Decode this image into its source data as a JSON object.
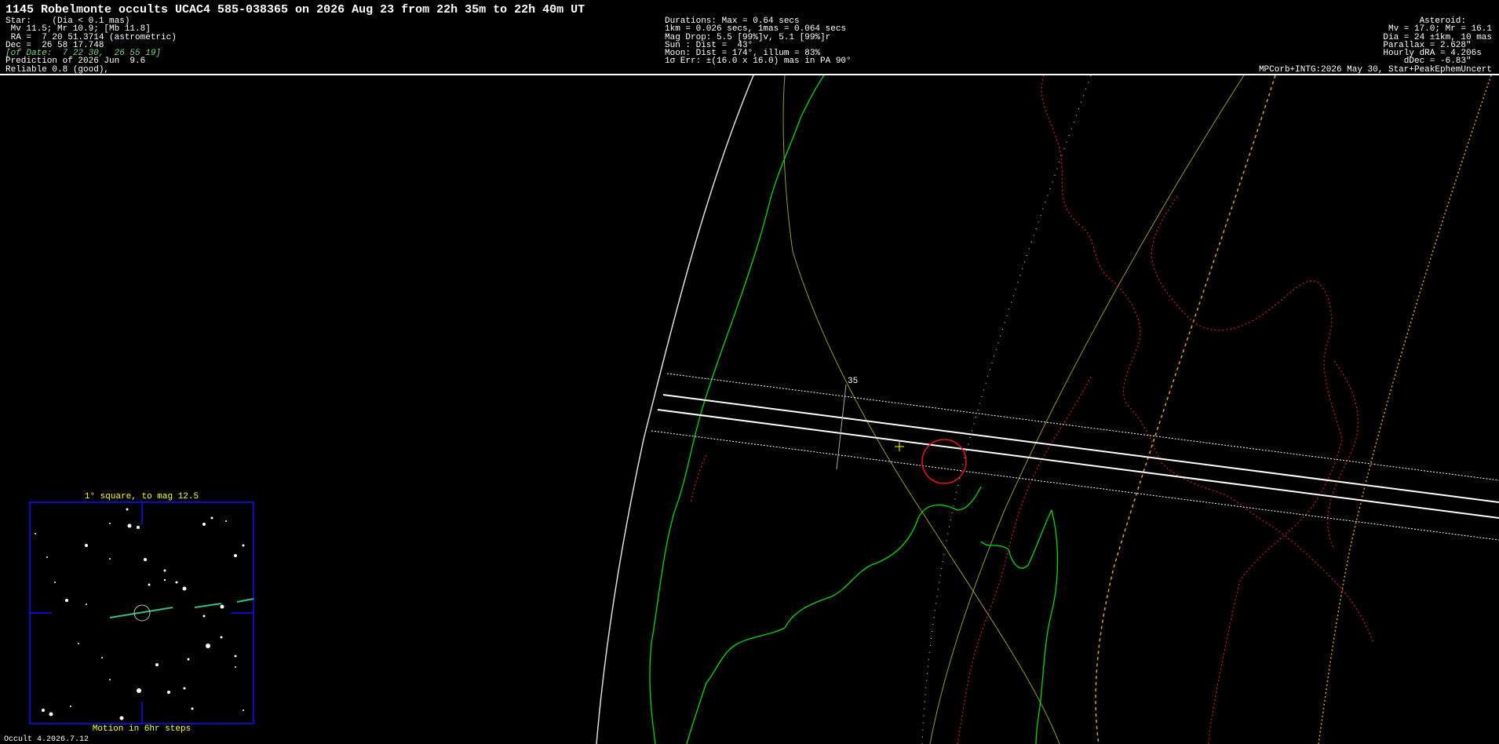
{
  "header": {
    "title": "1145 Robelmonte occults UCAC4 585-038365 on 2026 Aug 23 from 22h 35m to 22h 40m UT"
  },
  "star": {
    "line1": "Star:    (Dia < 0.1 mas)",
    "line2": " Mv 11.5; Mr 10.9; [Mb 11.8]",
    "line3": " RA =  7 20 51.3714 (astrometric)",
    "line4": "Dec =  26 58 17.748",
    "line5": "[of Date:  7 22 30,  26 55 19]",
    "line6": "Prediction of 2026 Jun  9.6",
    "line7": "Reliable 0.8 (good),"
  },
  "event": {
    "line1": "Durations: Max = 0.64 secs",
    "line2": "1km = 0.026 secs, 1mas = 0.064 secs",
    "line3": "Mag Drop: 5.5 [99%]v, 5.1 [99%]r",
    "line4": "Sun : Dist =  43°",
    "line5": "Moon: Dist = 174°, illum = 83%",
    "line6": "1σ Err: ±(16.0 x 16.0) mas in PA 90°"
  },
  "asteroid": {
    "line1": "Asteroid:     ",
    "line2": "Mv = 17.0; Mr = 16.1",
    "line3": "Dia = 24 ±1km, 10 mas",
    "line4": "Parallax = 2.628\"    ",
    "line5": "Hourly dRA = 4.206s  ",
    "line6": "dDec = -6.83\"    ",
    "line7": "MPCorb+INTG:2026 May 30, Star+PeakEphemUncert"
  },
  "map": {
    "path_label": "35"
  },
  "finder": {
    "title": "1° square, to mag 12.5",
    "motion": "Motion in 6hr steps"
  },
  "footer": {
    "version": "Occult 4.2026.7.12"
  },
  "colors": {
    "coastline": "#00dd00",
    "border": "#cc2222",
    "path": "#ffffff",
    "graticule": "#9a9a30",
    "twilight": "#e0a020",
    "finder_frame": "#1010ff",
    "label": "#ffff00"
  }
}
